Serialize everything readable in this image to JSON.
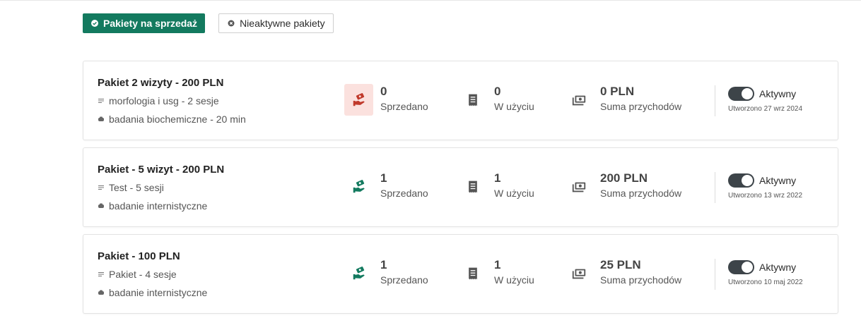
{
  "tabs": {
    "active_label": "Pakiety na sprzedaż",
    "inactive_label": "Nieaktywne pakiety"
  },
  "colors": {
    "accent": "#137a5f",
    "alert": "#c0392b",
    "alert_bg": "#fbe1de",
    "toggle": "#3d4449"
  },
  "icons": {
    "sold": "hand-cash-icon",
    "in_use": "document-icon",
    "revenue": "money-stack-icon",
    "session": "lines-icon",
    "service": "stethoscope-icon"
  },
  "packages": [
    {
      "title": "Pakiet 2 wizyty - 200 PLN",
      "line1": "morfologia i usg - 2 sesje",
      "line2": "badania biochemiczne - 20 min",
      "sold_value": "0",
      "sold_label": "Sprzedano",
      "sold_alert": true,
      "use_value": "0",
      "use_label": "W użyciu",
      "revenue_value": "0 PLN",
      "revenue_label": "Suma przychodów",
      "status_label": "Aktywny",
      "created": "Utworzono 27 wrz 2024"
    },
    {
      "title": "Pakiet - 5 wizyt - 200 PLN",
      "line1": "Test - 5 sesji",
      "line2": "badanie internistyczne",
      "sold_value": "1",
      "sold_label": "Sprzedano",
      "sold_alert": false,
      "use_value": "1",
      "use_label": "W użyciu",
      "revenue_value": "200 PLN",
      "revenue_label": "Suma przychodów",
      "status_label": "Aktywny",
      "created": "Utworzono 13 wrz 2022"
    },
    {
      "title": "Pakiet - 100 PLN",
      "line1": "Pakiet - 4 sesje",
      "line2": "badanie internistyczne",
      "sold_value": "1",
      "sold_label": "Sprzedano",
      "sold_alert": false,
      "use_value": "1",
      "use_label": "W użyciu",
      "revenue_value": "25 PLN",
      "revenue_label": "Suma przychodów",
      "status_label": "Aktywny",
      "created": "Utworzono 10 maj 2022"
    }
  ]
}
